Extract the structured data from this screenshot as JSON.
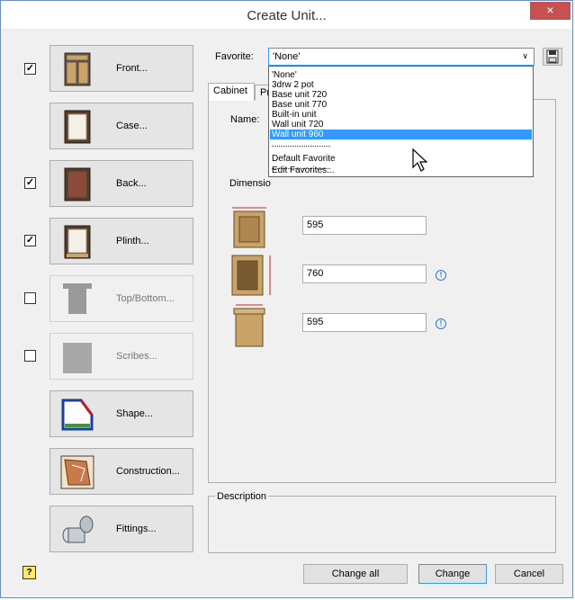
{
  "window": {
    "title": "Create Unit...",
    "close_label": "×"
  },
  "sidebar": {
    "items": [
      {
        "label": "Front...",
        "checked": true,
        "has_checkbox": true,
        "enabled": true
      },
      {
        "label": "Case...",
        "checked": false,
        "has_checkbox": false,
        "enabled": true
      },
      {
        "label": "Back...",
        "checked": true,
        "has_checkbox": true,
        "enabled": true
      },
      {
        "label": "Plinth...",
        "checked": true,
        "has_checkbox": true,
        "enabled": true
      },
      {
        "label": "Top/Bottom...",
        "checked": false,
        "has_checkbox": true,
        "enabled": false
      },
      {
        "label": "Scribes...",
        "checked": false,
        "has_checkbox": true,
        "enabled": false
      },
      {
        "label": "Shape...",
        "checked": false,
        "has_checkbox": false,
        "enabled": true
      },
      {
        "label": "Construction...",
        "checked": false,
        "has_checkbox": false,
        "enabled": true
      },
      {
        "label": "Fittings...",
        "checked": false,
        "has_checkbox": false,
        "enabled": true
      }
    ]
  },
  "favorite": {
    "label": "Favorite:",
    "value": "'None'",
    "save_icon": "floppy-disk-icon",
    "options": [
      "'None'",
      "3drw 2 pot",
      "Base unit 720",
      "Base unit 770",
      "Built-in unit",
      "Wall unit 720",
      "Wall unit 960"
    ],
    "selected_option": "Wall unit 960",
    "default_favorite": "Default Favorite",
    "edit_favorites": "Edit Favorites..."
  },
  "tabs": [
    {
      "label": "Cabinet"
    },
    {
      "label": "Pr"
    }
  ],
  "cabinet": {
    "name_label": "Name:",
    "dimensions_label": "Dimensio",
    "width_value": "595",
    "height_value": "760",
    "depth_value": "595"
  },
  "description": {
    "label": "Description"
  },
  "footer": {
    "help_icon": "help-icon",
    "change_all_label": "Change all",
    "change_label": "Change",
    "cancel_label": "Cancel"
  },
  "colors": {
    "selection": "#3399ff",
    "close_button": "#c75050",
    "wood": "#c8a46b"
  }
}
